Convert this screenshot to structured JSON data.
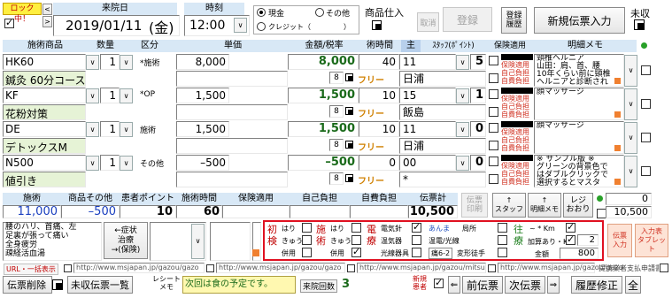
{
  "top": {
    "lock": "ロック中！",
    "visit_date_label": "来院日",
    "visit_date": "2019/01/11",
    "weekday": "(金)",
    "time_label": "時刻",
    "time": "12:00",
    "cash_label": "現金",
    "other_label": "その他",
    "credit_label": "クレジット（",
    "credit_close": "）",
    "product_in_label": "商品仕入",
    "cancel_label": "取消",
    "register_label": "登録",
    "reg_history_label": "登録\n履歴",
    "new_slip_label": "新規伝票入力",
    "unpaid_label": "未収"
  },
  "columns": {
    "treatment": "施術商品",
    "qty": "数量",
    "category": "区分",
    "unit_price": "単価",
    "amount_tax": "金額/税率",
    "duration": "術時間",
    "main": "主",
    "staff_point": "ｽﾀｯﾌ(ﾎﾟｲﾝﾄ)",
    "insurance": "保険適用",
    "memo": "明細メモ"
  },
  "rows": [
    {
      "code": "HK60",
      "qty": "1",
      "category": "*施術",
      "unit_price": "8,000",
      "amount": "8,000",
      "duration": "40",
      "staff_code": "11",
      "point": "5",
      "name": "鍼灸 60分コース",
      "tax": "8",
      "tax_mode": "フリー",
      "staff_name": "日浦",
      "ins": [
        "保険適用",
        "自己負担",
        "自費負担"
      ],
      "memo": "頸椎ヘルニア\n山田：肩、首、腰\n10年くらい前に頸椎\nヘルニアと診断され"
    },
    {
      "code": "KF",
      "qty": "1",
      "category": "*OP",
      "unit_price": "1,500",
      "amount": "1,500",
      "duration": "10",
      "staff_code": "15",
      "point": "1",
      "name": "花粉対策",
      "tax": "8",
      "tax_mode": "フリー",
      "staff_name": "飯島",
      "ins": [
        "保険適用",
        "自己負担",
        "自費負担"
      ],
      "memo": "顔マッサージ"
    },
    {
      "code": "DE",
      "qty": "1",
      "category": "施術",
      "unit_price": "1,500",
      "amount": "1,500",
      "duration": "10",
      "staff_code": "11",
      "point": "0",
      "name": "デトックスM",
      "tax": "8",
      "tax_mode": "フリー",
      "staff_name": "日浦",
      "ins": [
        "保険適用",
        "自己負担",
        "自費負担"
      ],
      "memo": "顔マッサージ"
    },
    {
      "code": "N500",
      "qty": "1",
      "category": "その他",
      "unit_price": "–500",
      "amount": "–500",
      "duration": "0",
      "staff_code": "00",
      "point": "0",
      "name": "値引き",
      "tax": "8",
      "tax_mode": "フリー",
      "staff_name": "*",
      "ins": [
        "保険適用",
        "自己負担",
        "自費負担"
      ],
      "memo": "※ サンプル版 ※\nグリーンの背景色で\nはダブルクリックで\n選択するとマスタ"
    }
  ],
  "totals_labels": {
    "treatment": "施術",
    "product_other": "商品その他",
    "point": "患者ポイント",
    "duration": "施術時間",
    "insurance": "保険適用",
    "self_pay": "自己負担",
    "own_pay": "自費負担",
    "slip_total": "伝票計"
  },
  "totals": {
    "treatment": "11,000",
    "product_other": "–500",
    "point": "10",
    "duration": "60",
    "slip_total": "10,500"
  },
  "actions": {
    "slip_print": "伝票\n印刷",
    "staff": "↑\nスタッフ",
    "memo": "↑\n明細メモ",
    "receipt": "レジ\nおおり",
    "right_value_1": "0",
    "right_value_2": "10,500"
  },
  "symptoms": {
    "text": "腰のハリ、首痛、左\n足裏が張って痛い\n全身疲労\n疎経活血湯",
    "nav": "←症状\n治療\n→(保険)"
  },
  "care": {
    "first_label": "初\n検",
    "hari": "はり",
    "kyu": "きゅう",
    "use": "併用",
    "apply_label": "施\n術",
    "electric_label": "電\n療",
    "elec_items": [
      "電気針",
      "温気器",
      "光線器具"
    ],
    "massage_items": [
      "あんま",
      "局所",
      "温電/光線",
      "痛6-2",
      "変形徒手"
    ],
    "traffic_label": "往\n療",
    "km_label": "~ * Km",
    "extra_label": "加算あり・Km",
    "extra_value": "2",
    "fee_label": "金額",
    "fee_value": "800",
    "dental_label": "伝票\n入力",
    "tablet_label": "入力表\nタブレット"
  },
  "links": {
    "url_label": "URL・一括表示",
    "url1": "http://www.msjapan.jp/gazou/gazo",
    "url2": "http://www.msjapan.jp/gazou/gazo",
    "url3": "http://www.msjapan.jp/gazou/mitsu",
    "url4": "http://www.msjapan.jp/gazou/gazo",
    "coupon_text": "提携業者支払申請書を利用しない"
  },
  "bottom": {
    "delete_label": "伝票削除",
    "unpaid_list": "未収伝票一覧",
    "receipt_memo_label": "レシート\nメモ",
    "next_visit": "次回は食の予定です。",
    "visit_count_label": "来院回数",
    "visit_count": "3",
    "new_patient_label": "新規\n患者",
    "prev_slip": "前伝票",
    "next_slip": "次伝票",
    "history_fix": "履歴修正",
    "all": "全"
  },
  "colors": {
    "header_bg": "#d8e8f6",
    "green_bg": "#e6f3d6",
    "red_text": "#c00000",
    "frame_red": "#e01020"
  }
}
